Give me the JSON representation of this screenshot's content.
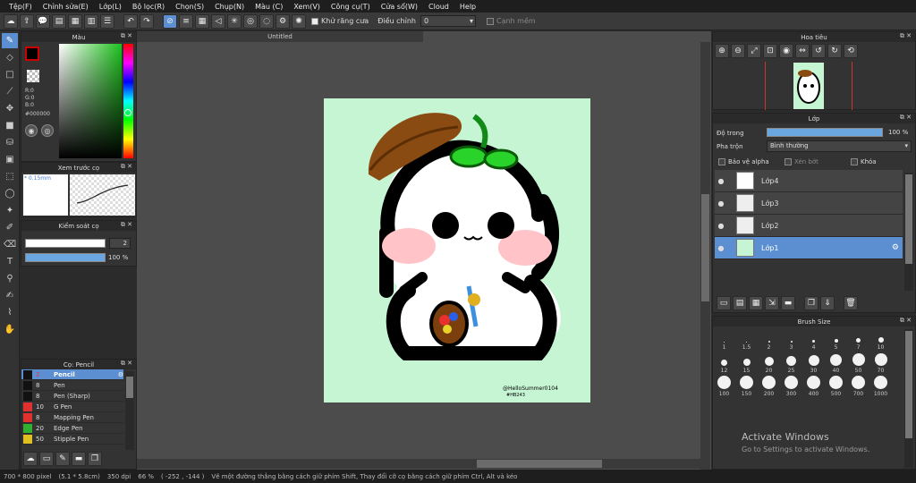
{
  "menu": [
    "Tệp(F)",
    "Chỉnh sửa(E)",
    "Lớp(L)",
    "Bộ lọc(R)",
    "Chọn(S)",
    "Chụp(N)",
    "Màu (C)",
    "Xem(V)",
    "Công cụ(T)",
    "Cửa sổ(W)",
    "Cloud",
    "Help"
  ],
  "toolbar": {
    "antialias": "Khử răng cưa",
    "correction": "Điều chỉnh",
    "correction_value": "0",
    "soft_edge": "Cạnh mềm"
  },
  "color_panel": {
    "title": "Màu",
    "r": "R:0",
    "g": "G:0",
    "b": "B:0",
    "hex": "#000000"
  },
  "brush_preview": {
    "title": "Xem trước cọ",
    "size": "* 0.15mm"
  },
  "brush_control": {
    "title": "Kiểm soát cọ",
    "size": "2",
    "opacity": "100 %"
  },
  "brush_list": {
    "title": "Cọ: Pencil",
    "items": [
      {
        "size": "2",
        "name": "Pencil",
        "color": "#111111"
      },
      {
        "size": "8",
        "name": "Pen",
        "color": "#111111"
      },
      {
        "size": "8",
        "name": "Pen (Sharp)",
        "color": "#111111"
      },
      {
        "size": "10",
        "name": "G Pen",
        "color": "#e03030"
      },
      {
        "size": "8",
        "name": "Mapping Pen",
        "color": "#e03030"
      },
      {
        "size": "20",
        "name": "Edge Pen",
        "color": "#30b030"
      },
      {
        "size": "50",
        "name": "Stipple Pen",
        "color": "#e0c020"
      }
    ]
  },
  "canvas": {
    "tab": "Untitled",
    "signature": "@HelloSummer0104",
    "signature2": "#HB243"
  },
  "navigator": {
    "title": "Hoa tiêu"
  },
  "layers": {
    "title": "Lớp",
    "opacity_label": "Độ trong",
    "opacity_value": "100 %",
    "blend_label": "Pha trộn",
    "blend_value": "Bình thường",
    "protect_alpha": "Bảo vệ alpha",
    "clip": "Xén bớt",
    "lock": "Khóa",
    "items": [
      "Lớp4",
      "Lớp3",
      "Lớp2",
      "Lớp1"
    ]
  },
  "brush_size": {
    "title": "Brush Size",
    "sizes": [
      "1",
      "1.5",
      "2",
      "3",
      "4",
      "5",
      "7",
      "10",
      "12",
      "15",
      "20",
      "25",
      "30",
      "40",
      "50",
      "70",
      "100",
      "150",
      "200",
      "300",
      "400",
      "500",
      "700",
      "1000"
    ]
  },
  "status": {
    "dims": "700 * 800 pixel",
    "cm": "(5.1 * 5.8cm)",
    "dpi": "350 dpi",
    "zoom": "66 %",
    "coords": "( -252 , -144 )",
    "hint": "Vẽ một đường thẳng bằng cách giữ phím Shift, Thay đổi cỡ cọ bằng cách giữ phím Ctrl, Alt và kéo"
  },
  "watermark": {
    "line1": "Activate Windows",
    "line2": "Go to Settings to activate Windows."
  }
}
